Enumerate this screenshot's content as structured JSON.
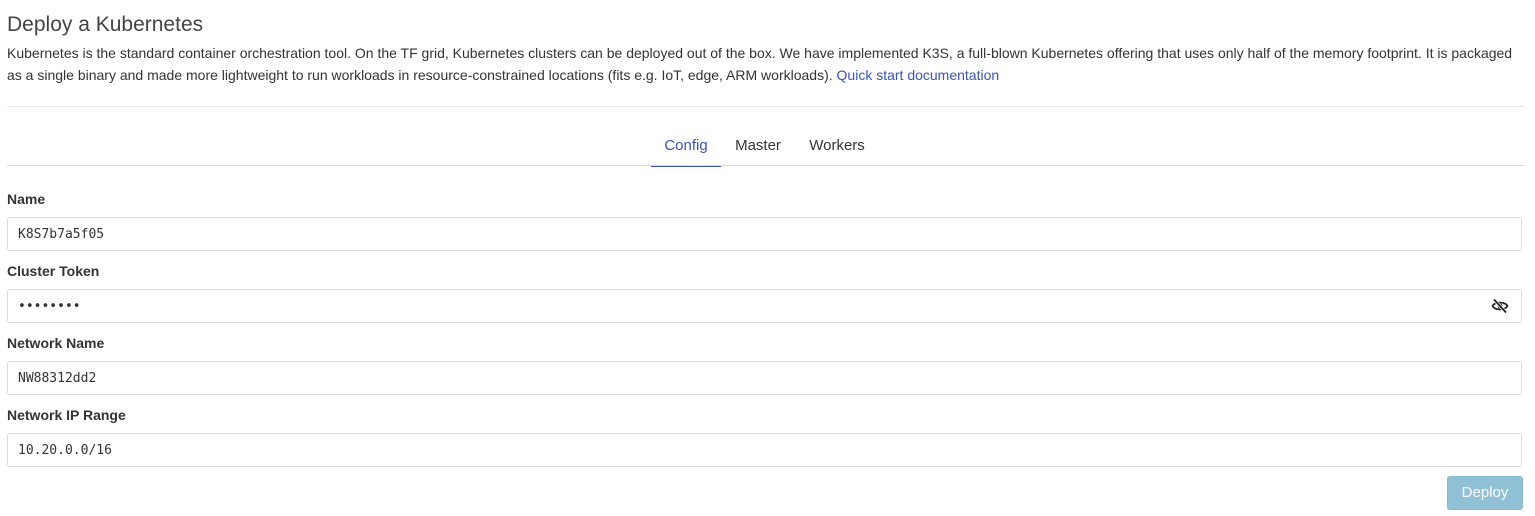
{
  "page": {
    "title": "Deploy a Kubernetes",
    "description": "Kubernetes is the standard container orchestration tool. On the TF grid, Kubernetes clusters can be deployed out of the box. We have implemented K3S, a full-blown Kubernetes offering that uses only half of the memory footprint. It is packaged as a single binary and made more lightweight to run workloads in resource-constrained locations (fits e.g. IoT, edge, ARM workloads).",
    "doc_link": "Quick start documentation"
  },
  "tabs": [
    {
      "label": "Config",
      "active": true
    },
    {
      "label": "Master",
      "active": false
    },
    {
      "label": "Workers",
      "active": false
    }
  ],
  "form": {
    "name_label": "Name",
    "name_value": "K8S7b7a5f05",
    "token_label": "Cluster Token",
    "token_value": "••••••••",
    "network_name_label": "Network Name",
    "network_name_value": "NW88312dd2",
    "ip_range_label": "Network IP Range",
    "ip_range_value": "10.20.0.0/16"
  },
  "icons": {
    "token_visibility": "eye-off-icon"
  },
  "actions": {
    "deploy_label": "Deploy"
  },
  "colors": {
    "accent": "#3b54b4",
    "deploy_button": "#91c1d6"
  }
}
